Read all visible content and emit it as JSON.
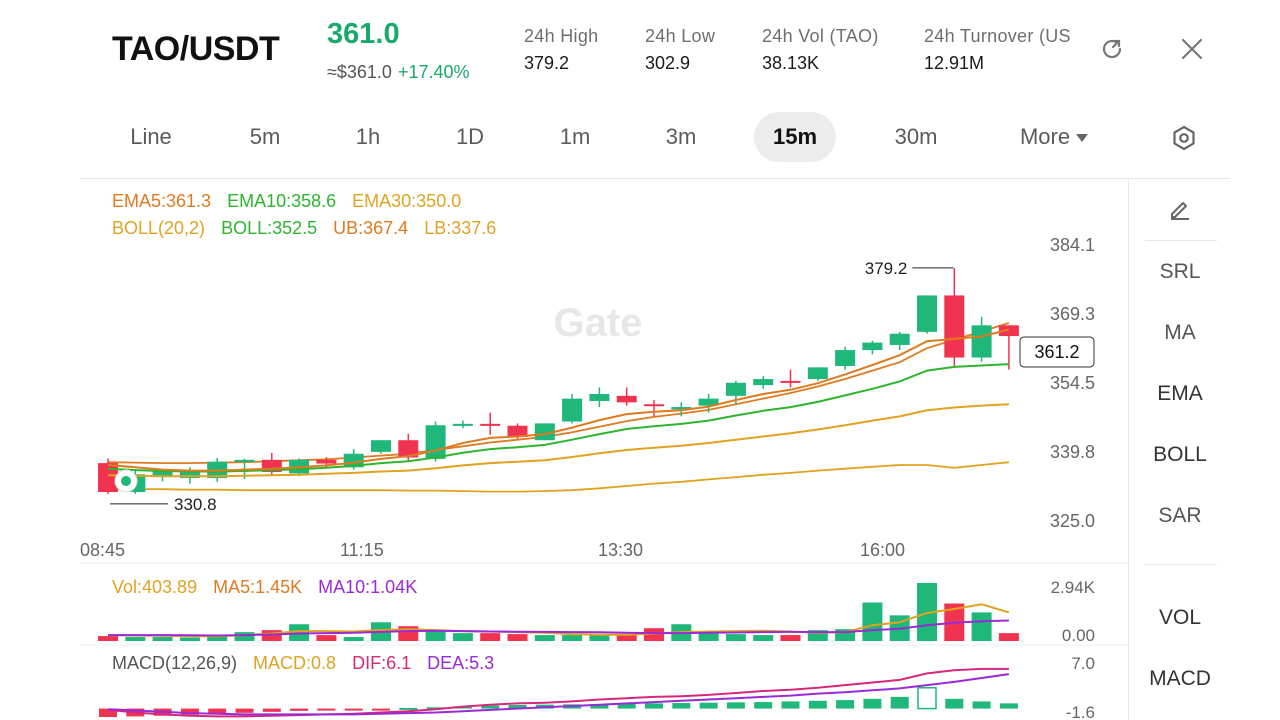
{
  "header": {
    "pair": "TAO/USDT",
    "price": "361.0",
    "approx_price": "≈$361.0",
    "change": "+17.40%",
    "stats": [
      {
        "label": "24h  High",
        "value": "379.2"
      },
      {
        "label": "24h  Low",
        "value": "302.9"
      },
      {
        "label": "24h  Vol (TAO)",
        "value": "38.13K"
      },
      {
        "label": "24h  Turnover (US",
        "value": "12.91M"
      }
    ],
    "icons": [
      "share-icon",
      "close-icon"
    ]
  },
  "intervals": {
    "items": [
      "Line",
      "5m",
      "1h",
      "1D",
      "1m",
      "3m",
      "15m",
      "30m",
      "More"
    ],
    "active": "15m",
    "settings_icon": "settings-hexagon-icon"
  },
  "indicators": {
    "ema": [
      "EMA5:361.3",
      "EMA10:358.6",
      "EMA30:350.0"
    ],
    "boll": [
      "BOLL(20,2)",
      "BOLL:352.5",
      "UB:367.4",
      "LB:337.6"
    ],
    "vol": [
      "Vol:403.89",
      "MA5:1.45K",
      "MA10:1.04K"
    ],
    "macd": [
      "MACD(12,26,9)",
      "MACD:0.8",
      "DIF:6.1",
      "DEA:5.3"
    ]
  },
  "watermark": "Gate",
  "tools": {
    "items": [
      "SRL",
      "MA",
      "EMA",
      "BOLL",
      "SAR",
      "VOL",
      "MACD"
    ],
    "edit_icon": "pencil-icon"
  },
  "colors": {
    "up": "#1fb77a",
    "down": "#f0344f",
    "ema5": "#e07a1f",
    "ema10": "#2db52d",
    "ema30": "#e0a21f",
    "macd_pink": "#d6287a",
    "ma10_purple": "#9a2ad6"
  },
  "chart_data": {
    "type": "candlestick",
    "price_axis": {
      "ticks": [
        "384.1",
        "369.3",
        "354.5",
        "339.8",
        "325.0"
      ],
      "range": [
        325.0,
        384.1
      ]
    },
    "time_axis": {
      "ticks": [
        "08:45",
        "11:15",
        "13:30",
        "16:00"
      ]
    },
    "last_price_label": "361.2",
    "high_label": "379.2",
    "low_label": "330.8",
    "candles": [
      {
        "o": 337.4,
        "h": 338.4,
        "l": 330.8,
        "c": 331.2
      },
      {
        "o": 331.2,
        "h": 336.0,
        "l": 330.8,
        "c": 335.0
      },
      {
        "o": 334.4,
        "h": 336.0,
        "l": 333.5,
        "c": 335.6
      },
      {
        "o": 334.2,
        "h": 336.5,
        "l": 333.0,
        "c": 335.6
      },
      {
        "o": 334.2,
        "h": 338.5,
        "l": 333.4,
        "c": 337.7
      },
      {
        "o": 337.7,
        "h": 338.3,
        "l": 334.0,
        "c": 338.1
      },
      {
        "o": 338.1,
        "h": 339.6,
        "l": 334.6,
        "c": 335.5
      },
      {
        "o": 335.2,
        "h": 338.4,
        "l": 334.6,
        "c": 338.1
      },
      {
        "o": 338.1,
        "h": 338.7,
        "l": 336.3,
        "c": 337.3
      },
      {
        "o": 336.5,
        "h": 340.4,
        "l": 336.0,
        "c": 339.4
      },
      {
        "o": 339.8,
        "h": 342.3,
        "l": 339.4,
        "c": 342.3
      },
      {
        "o": 342.3,
        "h": 343.7,
        "l": 337.7,
        "c": 338.6
      },
      {
        "o": 338.3,
        "h": 346.3,
        "l": 337.7,
        "c": 345.5
      },
      {
        "o": 345.5,
        "h": 346.5,
        "l": 344.9,
        "c": 345.8
      },
      {
        "o": 345.8,
        "h": 348.2,
        "l": 343.5,
        "c": 345.4
      },
      {
        "o": 345.4,
        "h": 345.9,
        "l": 342.6,
        "c": 343.0
      },
      {
        "o": 342.3,
        "h": 345.9,
        "l": 342.3,
        "c": 345.9
      },
      {
        "o": 346.3,
        "h": 352.2,
        "l": 345.9,
        "c": 351.2
      },
      {
        "o": 350.7,
        "h": 353.6,
        "l": 349.4,
        "c": 352.2
      },
      {
        "o": 351.8,
        "h": 353.6,
        "l": 349.7,
        "c": 350.4
      },
      {
        "o": 350.0,
        "h": 350.9,
        "l": 347.4,
        "c": 349.7
      },
      {
        "o": 348.9,
        "h": 350.4,
        "l": 347.4,
        "c": 349.4
      },
      {
        "o": 349.7,
        "h": 352.2,
        "l": 348.2,
        "c": 351.2
      },
      {
        "o": 351.8,
        "h": 355.0,
        "l": 350.0,
        "c": 354.6
      },
      {
        "o": 354.1,
        "h": 356.0,
        "l": 353.3,
        "c": 355.4
      },
      {
        "o": 355.0,
        "h": 357.4,
        "l": 353.6,
        "c": 354.6
      },
      {
        "o": 355.4,
        "h": 357.9,
        "l": 355.0,
        "c": 357.9
      },
      {
        "o": 358.2,
        "h": 362.3,
        "l": 357.4,
        "c": 361.6
      },
      {
        "o": 361.6,
        "h": 363.6,
        "l": 360.7,
        "c": 363.2
      },
      {
        "o": 362.7,
        "h": 365.5,
        "l": 361.6,
        "c": 365.1
      },
      {
        "o": 365.5,
        "h": 373.3,
        "l": 365.1,
        "c": 373.3
      },
      {
        "o": 373.3,
        "h": 379.2,
        "l": 358.2,
        "c": 360.0
      },
      {
        "o": 360.0,
        "h": 368.7,
        "l": 359.1,
        "c": 366.9
      },
      {
        "o": 366.9,
        "h": 366.9,
        "l": 357.4,
        "c": 364.6
      }
    ],
    "ema5": [
      337.0,
      336.5,
      336.0,
      335.8,
      335.8,
      336.0,
      336.2,
      336.5,
      336.9,
      337.5,
      338.3,
      338.9,
      340.1,
      341.7,
      342.8,
      343.1,
      343.6,
      345.0,
      346.6,
      347.9,
      348.4,
      348.7,
      349.5,
      350.9,
      352.2,
      353.1,
      354.5,
      356.4,
      358.4,
      360.5,
      363.5,
      364.0,
      364.5,
      366.0
    ],
    "ema10": [
      336.2,
      335.9,
      335.7,
      335.6,
      335.6,
      335.7,
      335.9,
      336.1,
      336.4,
      336.8,
      337.4,
      337.8,
      338.6,
      339.6,
      340.4,
      340.8,
      341.3,
      342.4,
      343.6,
      344.7,
      345.3,
      345.8,
      346.5,
      347.6,
      348.6,
      349.4,
      350.5,
      351.9,
      353.3,
      354.9,
      357.2,
      358.0,
      358.3,
      358.6
    ],
    "ema30": [
      334.8,
      334.7,
      334.6,
      334.6,
      334.6,
      334.7,
      334.8,
      334.9,
      335.1,
      335.3,
      335.6,
      335.8,
      336.3,
      336.9,
      337.4,
      337.7,
      338.0,
      338.7,
      339.5,
      340.2,
      340.7,
      341.1,
      341.7,
      342.4,
      343.1,
      343.8,
      344.6,
      345.5,
      346.5,
      347.4,
      348.7,
      349.3,
      349.7,
      350.0
    ],
    "boll_ub": [
      337.6,
      337.5,
      337.4,
      337.4,
      337.5,
      337.6,
      337.8,
      338.0,
      338.2,
      338.6,
      339.0,
      339.4,
      340.2,
      341.0,
      341.8,
      342.4,
      343.0,
      344.0,
      345.2,
      346.4,
      347.3,
      348.0,
      348.8,
      350.0,
      351.2,
      352.4,
      353.8,
      355.4,
      357.2,
      359.0,
      362.0,
      363.8,
      365.6,
      367.4
    ],
    "boll_lb": [
      331.8,
      331.8,
      331.8,
      331.7,
      331.7,
      331.6,
      331.6,
      331.6,
      331.6,
      331.6,
      331.6,
      331.5,
      331.5,
      331.4,
      331.3,
      331.3,
      331.4,
      331.6,
      332.0,
      332.5,
      333.0,
      333.4,
      333.9,
      334.4,
      334.9,
      335.3,
      335.8,
      336.2,
      336.6,
      337.0,
      337.0,
      336.4,
      337.0,
      337.6
    ],
    "volume": [
      0.25,
      0.2,
      0.2,
      0.18,
      0.25,
      0.45,
      0.55,
      0.85,
      0.3,
      0.2,
      0.95,
      0.75,
      0.5,
      0.4,
      0.4,
      0.35,
      0.3,
      0.3,
      0.3,
      0.3,
      0.65,
      0.85,
      0.45,
      0.35,
      0.3,
      0.3,
      0.55,
      0.6,
      1.95,
      1.3,
      2.94,
      1.9,
      1.45,
      0.4
    ],
    "vol_ma5": [
      0.3,
      0.28,
      0.27,
      0.25,
      0.24,
      0.3,
      0.38,
      0.5,
      0.5,
      0.48,
      0.56,
      0.6,
      0.55,
      0.5,
      0.48,
      0.45,
      0.42,
      0.35,
      0.32,
      0.31,
      0.38,
      0.45,
      0.48,
      0.5,
      0.52,
      0.48,
      0.42,
      0.44,
      0.8,
      0.95,
      1.42,
      1.62,
      1.86,
      1.45
    ],
    "vol_ma10": [
      0.3,
      0.3,
      0.3,
      0.29,
      0.28,
      0.3,
      0.33,
      0.38,
      0.4,
      0.42,
      0.46,
      0.5,
      0.52,
      0.5,
      0.48,
      0.47,
      0.46,
      0.45,
      0.44,
      0.42,
      0.4,
      0.4,
      0.42,
      0.43,
      0.45,
      0.46,
      0.45,
      0.45,
      0.55,
      0.62,
      0.8,
      0.93,
      1.0,
      1.04
    ],
    "macd_hist": [
      -1.3,
      -1.2,
      -1.1,
      -0.95,
      -0.8,
      -0.65,
      -0.5,
      -0.35,
      -0.25,
      -0.15,
      -0.05,
      0.1,
      0.2,
      0.35,
      0.45,
      0.55,
      0.6,
      0.65,
      0.7,
      0.75,
      0.8,
      0.85,
      0.9,
      0.95,
      1.0,
      1.1,
      1.2,
      1.3,
      1.5,
      1.8,
      3.2,
      1.5,
      1.1,
      0.8
    ],
    "macd_dif": [
      -0.2,
      -0.6,
      -0.9,
      -1.1,
      -1.2,
      -1.2,
      -1.1,
      -1.0,
      -0.9,
      -0.8,
      -0.6,
      -0.4,
      -0.1,
      0.3,
      0.6,
      0.8,
      0.9,
      1.1,
      1.4,
      1.6,
      1.8,
      1.9,
      2.1,
      2.4,
      2.7,
      2.9,
      3.2,
      3.6,
      4.0,
      4.4,
      5.4,
      5.9,
      6.1,
      6.1
    ],
    "macd_dea": [
      -0.1,
      -0.3,
      -0.5,
      -0.7,
      -0.8,
      -0.9,
      -0.9,
      -0.9,
      -0.9,
      -0.9,
      -0.8,
      -0.7,
      -0.6,
      -0.4,
      -0.2,
      0.0,
      0.2,
      0.4,
      0.6,
      0.8,
      1.0,
      1.2,
      1.4,
      1.6,
      1.8,
      2.0,
      2.3,
      2.5,
      2.8,
      3.1,
      3.6,
      4.1,
      4.7,
      5.3
    ],
    "vol_axis": {
      "ticks": [
        "2.94K",
        "0.00"
      ]
    },
    "macd_axis": {
      "ticks": [
        "7.0",
        "-1.6"
      ]
    }
  }
}
